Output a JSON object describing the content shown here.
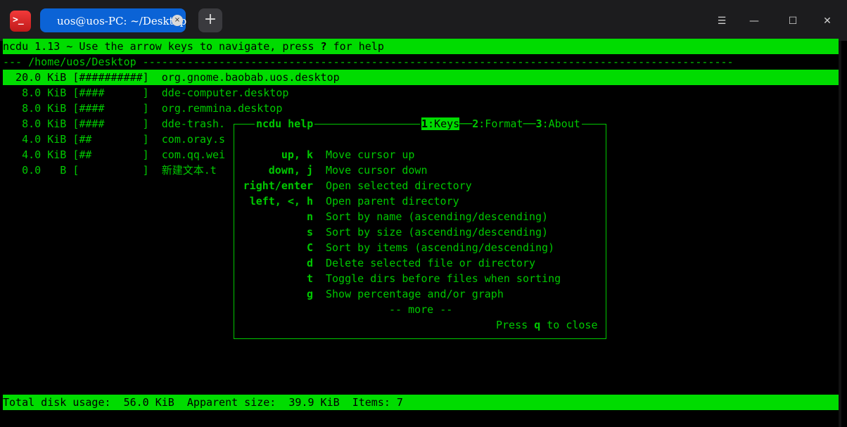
{
  "window": {
    "tab_title": "uos@uos-PC: ~/Desktop",
    "tab_close_glyph": "×",
    "new_tab_glyph": "+",
    "menu_glyph": "☰",
    "minimize_glyph": "—",
    "maximize_glyph": "☐",
    "close_glyph": "✕",
    "app_icon_glyph": ">_"
  },
  "ncdu": {
    "header_prefix": "ncdu 1.13 ~ Use the arrow keys to navigate, press ",
    "header_key": "?",
    "header_suffix": " for help",
    "path_line": "--- /home/uos/Desktop ---------------------------------------------------------------------------------------------",
    "rows": [
      {
        "size": "  20.0 KiB",
        "bar": "[##########]",
        "name": "org.gnome.baobab.uos.desktop",
        "selected": true
      },
      {
        "size": "   8.0 KiB",
        "bar": "[####      ]",
        "name": "dde-computer.desktop",
        "selected": false
      },
      {
        "size": "   8.0 KiB",
        "bar": "[####      ]",
        "name": "org.remmina.desktop",
        "selected": false
      },
      {
        "size": "   8.0 KiB",
        "bar": "[####      ]",
        "name": "dde-trash.",
        "selected": false
      },
      {
        "size": "   4.0 KiB",
        "bar": "[##        ]",
        "name": "com.oray.s",
        "selected": false
      },
      {
        "size": "   4.0 KiB",
        "bar": "[##        ]",
        "name": "com.qq.wei",
        "selected": false
      },
      {
        "size": "   0.0   B",
        "bar": "[          ]",
        "name": "新建文本.t",
        "selected": false
      }
    ],
    "footer": "Total disk usage:  56.0 KiB  Apparent size:  39.9 KiB  Items: 7"
  },
  "help": {
    "title": "ncdu help",
    "tabs": [
      {
        "num": "1",
        "label": ":Keys",
        "active": true
      },
      {
        "num": "2",
        "label": ":Format",
        "active": false
      },
      {
        "num": "3",
        "label": ":About",
        "active": false
      }
    ],
    "keys": [
      {
        "key": "up, k",
        "desc": "Move cursor up"
      },
      {
        "key": "down, j",
        "desc": "Move cursor down"
      },
      {
        "key": "right/enter",
        "desc": "Open selected directory"
      },
      {
        "key": "left, <, h",
        "desc": "Open parent directory"
      },
      {
        "key": "n",
        "desc": "Sort by name (ascending/descending)"
      },
      {
        "key": "s",
        "desc": "Sort by size (ascending/descending)"
      },
      {
        "key": "C",
        "desc": "Sort by items (ascending/descending)"
      },
      {
        "key": "d",
        "desc": "Delete selected file or directory"
      },
      {
        "key": "t",
        "desc": "Toggle dirs before files when sorting"
      },
      {
        "key": "g",
        "desc": "Show percentage and/or graph"
      }
    ],
    "more": "-- more --",
    "close_prefix": "Press ",
    "close_key": "q",
    "close_suffix": " to close"
  },
  "colors": {
    "terminal_fg": "#00c800",
    "highlight_bg": "#00dc00",
    "tab_bg": "#0b63d6"
  }
}
